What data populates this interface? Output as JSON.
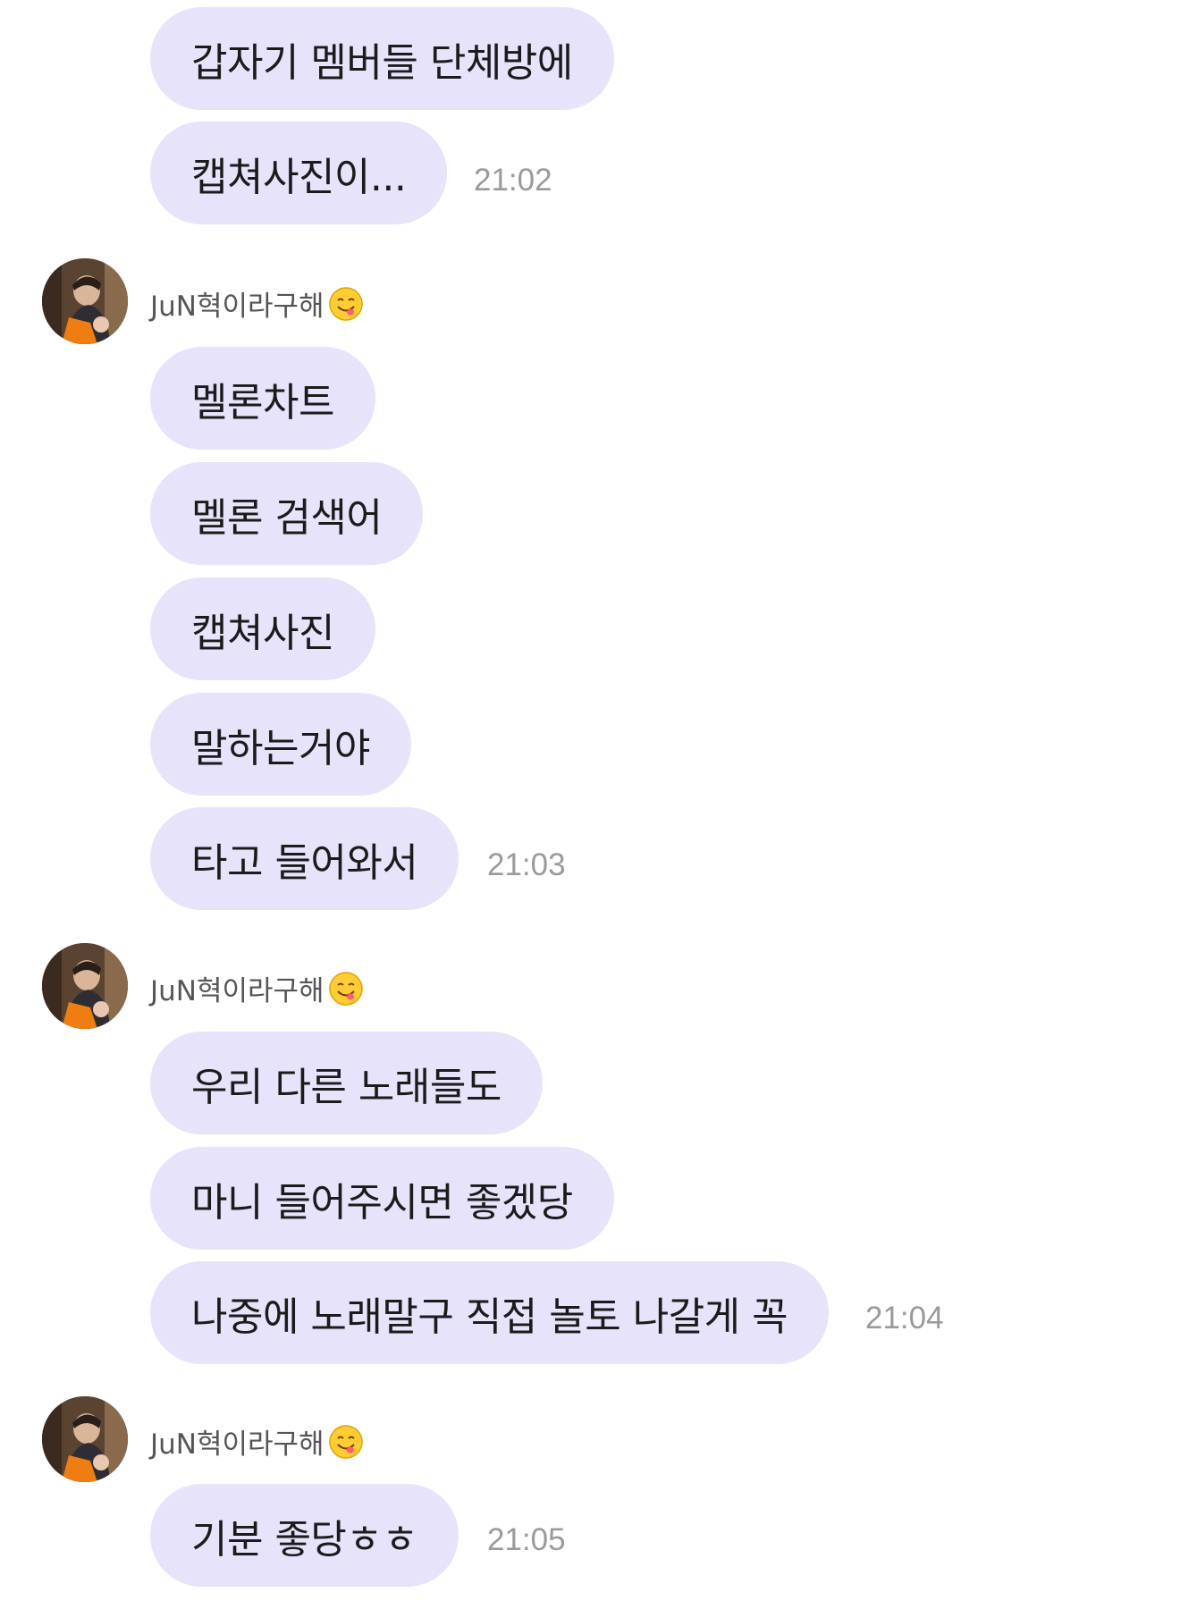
{
  "sender": {
    "name": "JuN혁이라구해"
  },
  "messages": [
    {
      "text": "갑자기 멤버들 단체방에"
    },
    {
      "text": "캡쳐사진이...",
      "time": "21:02"
    },
    {
      "text": "멜론차트"
    },
    {
      "text": "멜론 검색어"
    },
    {
      "text": "캡쳐사진"
    },
    {
      "text": "말하는거야"
    },
    {
      "text": "타고 들어와서",
      "time": "21:03"
    },
    {
      "text": "우리 다른 노래들도"
    },
    {
      "text": "마니 들어주시면 좋겠당"
    },
    {
      "text": "나중에 노래말구 직접 놀토 나갈게 꼭",
      "time": "21:04"
    },
    {
      "text": "기분 좋당ㅎㅎ",
      "time": "21:05"
    }
  ],
  "icons": {
    "avatar": "profile-photo",
    "name_emoji": "yum-face-emoji"
  },
  "colors": {
    "bubble": "#e6e3fb",
    "time": "#9a9a9a"
  }
}
